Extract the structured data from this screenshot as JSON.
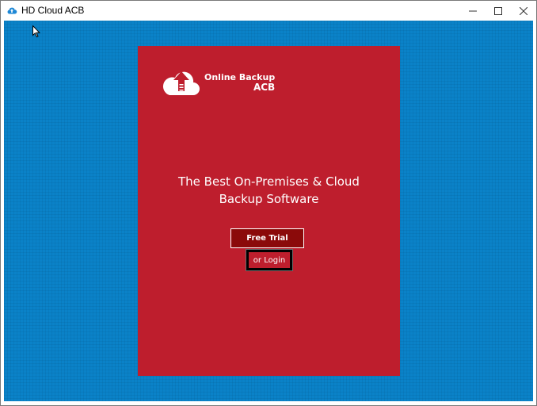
{
  "window": {
    "title": "HD Cloud ACB",
    "icons": {
      "app": "cloud-icon",
      "minimize": "minimize-icon",
      "maximize": "maximize-icon",
      "close": "close-icon"
    }
  },
  "panel": {
    "logo": {
      "line1": "Online Backup",
      "line2": "ACB",
      "icon": "cloud-upload-icon"
    },
    "headline_line1": "The Best On-Premises & Cloud",
    "headline_line2": "Backup Software",
    "free_trial_label": "Free Trial",
    "login_label": "or Login"
  },
  "colors": {
    "background_blue": "#0a82c8",
    "panel_red": "#be1e2d",
    "button_dark_red": "#8b0a0a",
    "text_white": "#ffffff"
  }
}
